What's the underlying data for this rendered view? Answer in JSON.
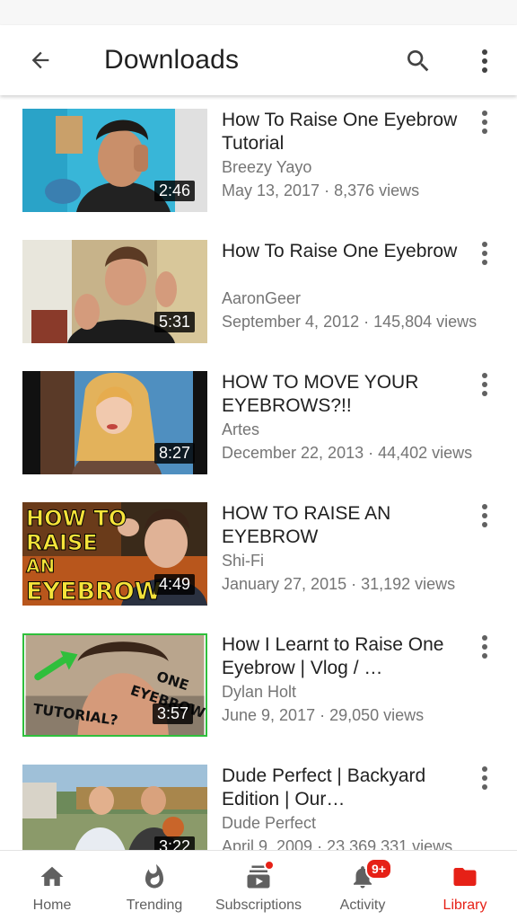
{
  "app_bar": {
    "title": "Downloads"
  },
  "videos": [
    {
      "title": "How To Raise One Eyebrow Tutorial",
      "channel": "Breezy Yayo",
      "meta": "May 13, 2017 · 8,376 views",
      "duration": "2:46"
    },
    {
      "title": "How To Raise One Eyebrow",
      "channel": "AaronGeer",
      "meta": "September 4, 2012 · 145,804 views",
      "duration": "5:31"
    },
    {
      "title": "HOW TO MOVE YOUR EYEBROWS?!!",
      "channel": "Artes",
      "meta": "December 22, 2013 · 44,402 views",
      "duration": "8:27"
    },
    {
      "title": "HOW TO RAISE AN EYEBROW",
      "channel": "Shi-Fi",
      "meta": "January 27, 2015 · 31,192 views",
      "duration": "4:49",
      "thumb_text": [
        "HOW TO",
        "RAISE",
        "AN",
        "EYEBROW"
      ]
    },
    {
      "title": "How I Learnt to Raise One Eyebrow | Vlog / …",
      "channel": "Dylan Holt",
      "meta": "June 9, 2017 · 29,050 views",
      "duration": "3:57",
      "thumb_text": [
        "ONE",
        "EYEBROW",
        "TUTORIAL?"
      ]
    },
    {
      "title": "Dude Perfect | Backyard Edition | Our…",
      "channel": "Dude Perfect",
      "meta": "April 9, 2009 · 23,369,331 views",
      "duration": "3:22"
    }
  ],
  "bottom_nav": [
    {
      "label": "Home",
      "icon": "home-icon"
    },
    {
      "label": "Trending",
      "icon": "flame-icon"
    },
    {
      "label": "Subscriptions",
      "icon": "subscriptions-icon"
    },
    {
      "label": "Activity",
      "icon": "bell-icon",
      "badge": "9+"
    },
    {
      "label": "Library",
      "icon": "folder-icon",
      "active": true
    }
  ],
  "colors": {
    "accent": "#e62117",
    "text_primary": "#212121",
    "text_secondary": "#757575"
  }
}
